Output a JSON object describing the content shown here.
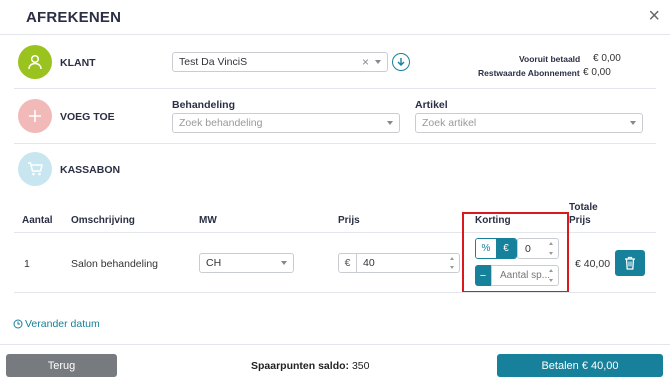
{
  "header": {
    "title": "AFREKENEN",
    "close_glyph": "×"
  },
  "klant": {
    "label": "KLANT",
    "selected": "Test Da VinciS",
    "clear_glyph": "×",
    "vooruit_label": "Vooruit betaald",
    "vooruit_value": "€ 0,00",
    "restwaarde_label": "Restwaarde Abonnement",
    "restwaarde_value": "€ 0,00"
  },
  "voeg_toe": {
    "label": "VOEG TOE",
    "behandeling_label": "Behandeling",
    "behandeling_placeholder": "Zoek behandeling",
    "artikel_label": "Artikel",
    "artikel_placeholder": "Zoek artikel"
  },
  "kassabon": {
    "label": "KASSABON",
    "columns": {
      "aantal": "Aantal",
      "omschrijving": "Omschrijving",
      "mw": "MW",
      "prijs": "Prijs",
      "korting": "Korting",
      "totale_line1": "Totale",
      "totale_line2": "Prijs"
    },
    "row": {
      "aantal": "1",
      "omschrijving": "Salon behandeling",
      "mw": "CH",
      "currency": "€",
      "prijs": "40",
      "korting_percent": "%",
      "korting_euro": "€",
      "korting_value": "0",
      "minus": "−",
      "spaarpunten_placeholder": "Aantal sp...",
      "totaal": "€ 40,00"
    }
  },
  "footer": {
    "verander_datum": "Verander datum",
    "terug": "Terug",
    "spaarpunten_label": "Spaarpunten saldo:",
    "spaarpunten_value": "350",
    "betalen": "Betalen € 40,00"
  },
  "colors": {
    "accent": "#17809a",
    "klant_circle": "#9bc31f",
    "voeg_circle": "#f2b9b9",
    "kassabon_circle": "#c7e6ef",
    "highlight": "#d9191e",
    "terug_button": "#777b7f"
  },
  "icons": [
    "user-icon",
    "plus-icon",
    "cart-icon",
    "download-icon",
    "clock-icon",
    "trash-icon",
    "close-icon"
  ]
}
